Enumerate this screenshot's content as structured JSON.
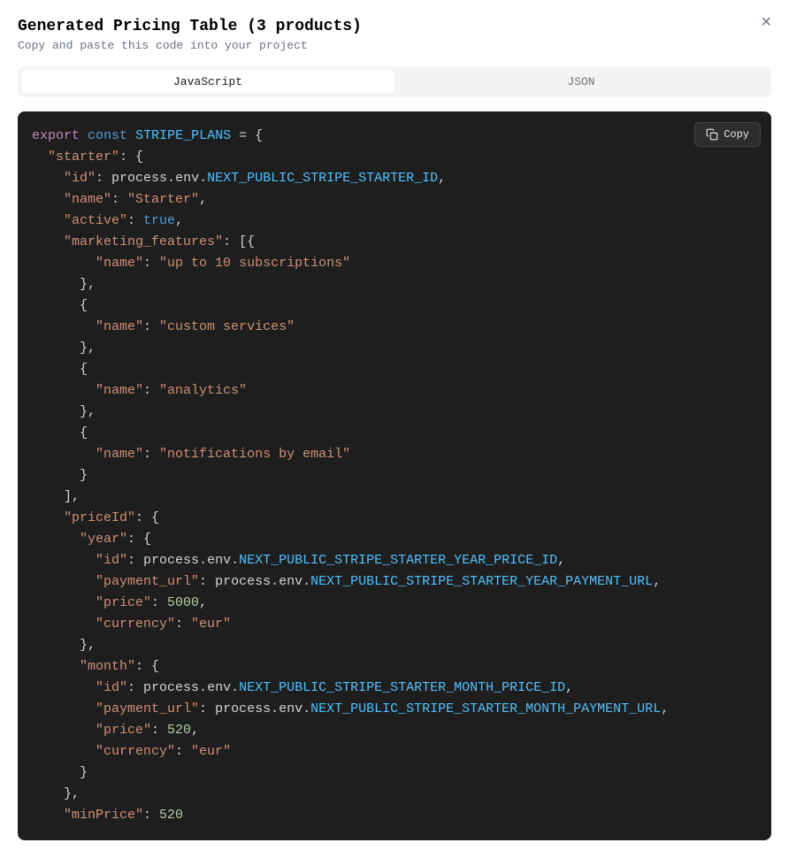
{
  "header": {
    "title": "Generated Pricing Table (3 products)",
    "subtitle": "Copy and paste this code into your project",
    "close_label": "×"
  },
  "tabs": {
    "js": "JavaScript",
    "json": "JSON"
  },
  "copy_label": "Copy",
  "code": {
    "kw_export": "export",
    "kw_const": "const",
    "varname": "STRIPE_PLANS",
    "eq": " = ",
    "brace_open": "{",
    "brace_close": "}",
    "bracket_open": "[",
    "bracket_close": "]",
    "colon": ": ",
    "comma": ",",
    "env_prefix": "process",
    "env_mid": "env",
    "dot": ".",
    "starter_key": "\"starter\"",
    "id_key": "\"id\"",
    "name_key": "\"name\"",
    "active_key": "\"active\"",
    "mf_key": "\"marketing_features\"",
    "priceid_key": "\"priceId\"",
    "year_key": "\"year\"",
    "month_key": "\"month\"",
    "payurl_key": "\"payment_url\"",
    "price_key": "\"price\"",
    "currency_key": "\"currency\"",
    "minprice_key": "\"minPrice\"",
    "starter_id_env": "NEXT_PUBLIC_STRIPE_STARTER_ID",
    "year_price_env": "NEXT_PUBLIC_STRIPE_STARTER_YEAR_PRICE_ID",
    "year_pay_env": "NEXT_PUBLIC_STRIPE_STARTER_YEAR_PAYMENT_URL",
    "month_price_env": "NEXT_PUBLIC_STRIPE_STARTER_MONTH_PRICE_ID",
    "month_pay_env": "NEXT_PUBLIC_STRIPE_STARTER_MONTH_PAYMENT_URL",
    "name_val": "\"Starter\"",
    "active_val": "true",
    "feat1": "\"up to 10 subscriptions\"",
    "feat2": "\"custom services\"",
    "feat3": "\"analytics\"",
    "feat4": "\"notifications by email\"",
    "price_5000": "5000",
    "price_520": "520",
    "eur": "\"eur\""
  }
}
